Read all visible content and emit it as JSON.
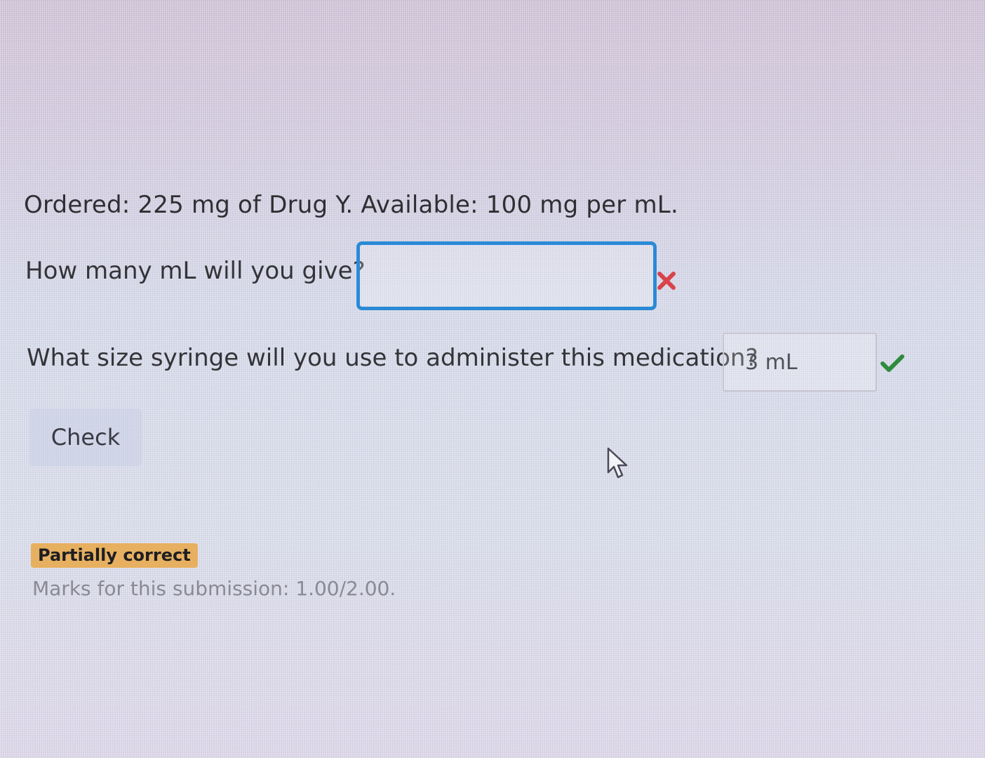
{
  "question": {
    "ordered_text": "Ordered:  225 mg of Drug Y.  Available: 100 mg per mL.",
    "prompt_1": "How many mL will you give?",
    "answer_1_value": "",
    "prompt_2": "What size syringe will you use to administer this medication?",
    "answer_2_value": "3 mL"
  },
  "actions": {
    "check_label": "Check"
  },
  "feedback": {
    "badge": "Partially correct",
    "marks": "Marks for this submission: 1.00/2.00."
  },
  "colors": {
    "focus_border": "#2a8ad6",
    "incorrect": "#d9434a",
    "correct": "#2e8b3e",
    "partial_badge": "#e7b060"
  },
  "icons": {
    "answer_1_status": "incorrect-cross-icon",
    "answer_2_status": "correct-checkmark-icon",
    "pointer": "mouse-cursor-icon"
  }
}
